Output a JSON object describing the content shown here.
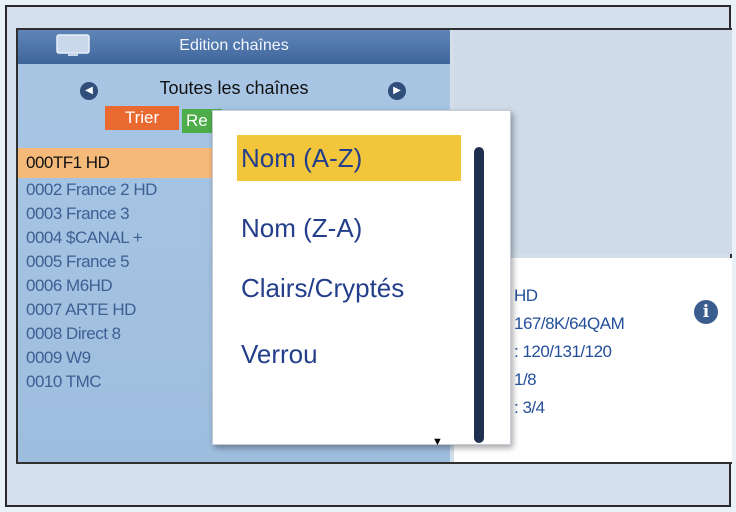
{
  "header": {
    "title": "Edition chaînes",
    "tv_icon": "tv-icon"
  },
  "filter": {
    "label": "Toutes les chaînes",
    "prev_icon": "arrow-left-icon",
    "next_icon": "arrow-right-icon"
  },
  "buttons": {
    "sort_label": "Trier",
    "green_label": "Re"
  },
  "channels": [
    "000TF1 HD",
    "0002 France 2 HD",
    "0003 France 3",
    "0004 $CANAL +",
    "0005 France 5",
    "0006 M6HD",
    "0007 ARTE HD",
    "0008 Direct 8",
    "0009 W9",
    "0010 TMC"
  ],
  "selected_channel_index": 0,
  "info": {
    "lines": [
      "HD",
      "167/8K/64QAM",
      ": 120/131/120",
      "1/8",
      ": 3/4"
    ],
    "icon": "info-icon"
  },
  "sort_menu": {
    "options": [
      "Nom (A-Z)",
      "Nom (Z-A)",
      "Clairs/Cryptés",
      "Verrou"
    ],
    "selected_index": 0
  },
  "colors": {
    "selected_option": "#f3c53a",
    "selected_channel": "#f5b979",
    "sort_button": "#ea6930"
  }
}
